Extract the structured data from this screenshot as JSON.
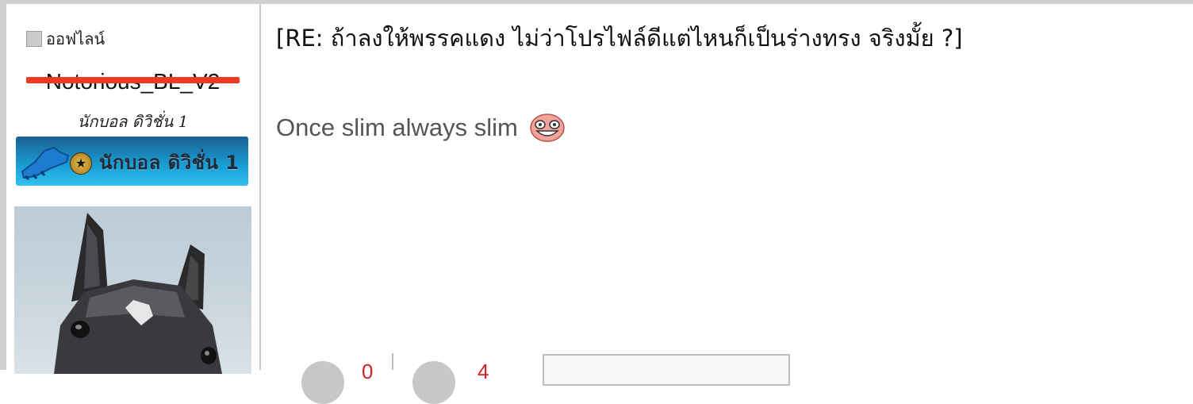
{
  "profile": {
    "status_label": "ออฟไลน์",
    "username": "Notorious_BL_V2",
    "rank_title": "นักบอล ดิวิชั่น 1",
    "badge_text": "นักบอล ดิวิชั่น 1"
  },
  "post": {
    "title": "[RE: ถ้าลงให้พรรคแดง ไม่ว่าโปรไฟล์ดีแต่ไหนก็เป็นร่างทรง จริงมั้ย ?]",
    "body": "Once slim always slim"
  },
  "reactions": {
    "like_count": "0",
    "dislike_count": "4"
  },
  "colors": {
    "strike": "#ee3a25",
    "count": "#d62222",
    "badge_start": "#1b5f93",
    "badge_end": "#30c1ef"
  },
  "icons": {
    "emoticon": "laughing-face-icon",
    "boot": "football-boot-icon",
    "star": "star-medal-icon"
  }
}
